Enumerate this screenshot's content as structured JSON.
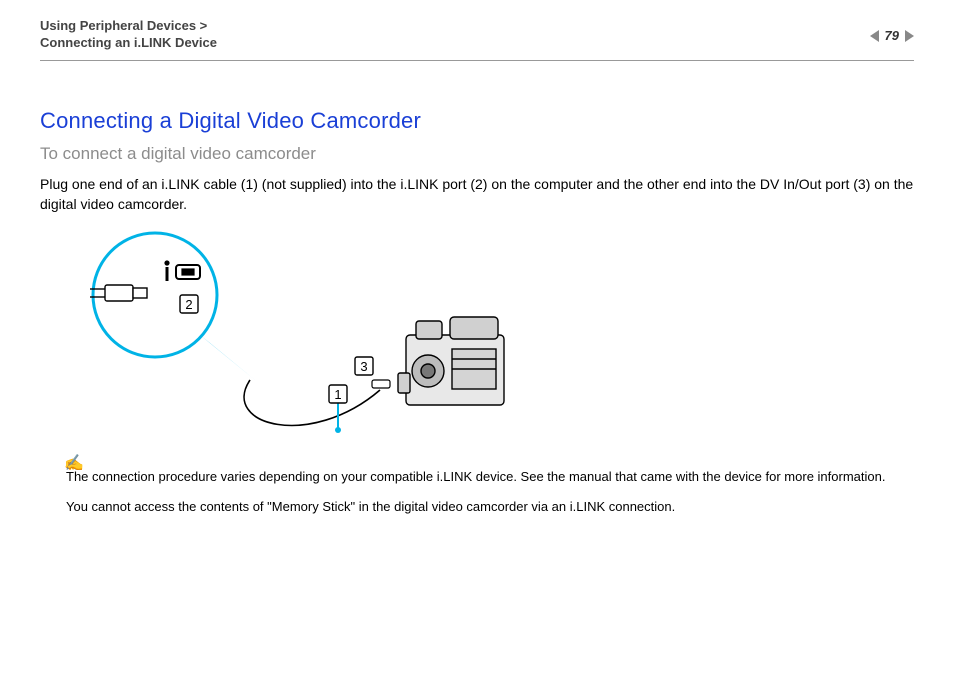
{
  "header": {
    "breadcrumb_line1": "Using Peripheral Devices >",
    "breadcrumb_line2": "Connecting an i.LINK Device",
    "page_number": "79"
  },
  "content": {
    "title": "Connecting a Digital Video Camcorder",
    "subtitle": "To connect a digital video camcorder",
    "body": "Plug one end of an i.LINK cable (1) (not supplied) into the i.LINK port (2) on the computer and the other end into the DV In/Out port (3) on the digital video camcorder."
  },
  "diagram": {
    "callouts": {
      "label1": "1",
      "label2": "2",
      "label3": "3"
    }
  },
  "notes": {
    "note1": "The connection procedure varies depending on your compatible i.LINK device. See the manual that came with the device for more information.",
    "note2": "You cannot access the contents of \"Memory Stick\" in the digital video camcorder via an i.LINK connection."
  }
}
